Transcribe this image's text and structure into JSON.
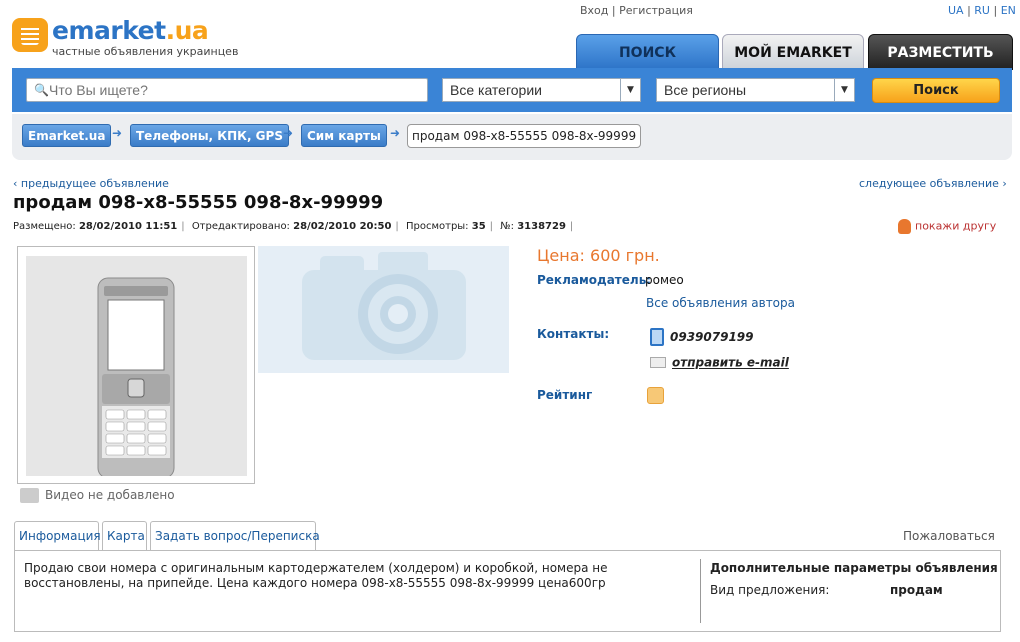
{
  "header": {
    "logo_text": "emarket",
    "logo_domain": ".ua",
    "logo_tagline": "частные объявления украинцев",
    "auth": {
      "login": "Вход",
      "register": "Регистрация"
    },
    "langs": [
      "UA",
      "RU",
      "EN"
    ],
    "tabs": {
      "search": "ПОИСК",
      "my": "МОЙ EMARKET",
      "post": "РАЗМЕСТИТЬ"
    }
  },
  "search": {
    "placeholder": "Что Вы ищете?",
    "category": "Все категории",
    "region": "Все регионы",
    "button": "Поиск"
  },
  "breadcrumb": {
    "items": [
      "Emarket.ua",
      "Телефоны, КПК, GPS",
      "Сим карты"
    ],
    "current": "продам 098-х8-55555 098-8х-99999"
  },
  "nav": {
    "prev": "‹ предыдущее объявление",
    "next": "следующее объявление ›"
  },
  "ad": {
    "title": "продам 098-х8-55555 098-8х-99999",
    "meta": {
      "posted_label": "Размещено:",
      "posted": "28/02/2010 11:51",
      "edited_label": "Отредактировано:",
      "edited": "28/02/2010 20:50",
      "views_label": "Просмотры:",
      "views": "35",
      "id_label": "№:",
      "id": "3138729"
    },
    "share": "покажи другу",
    "video": "Видео не добавлено",
    "price": "Цена: 600 грн.",
    "advertiser_label": "Рекламодатель:",
    "advertiser": "ромео",
    "author_link": "Все объявления автора",
    "contacts_label": "Контакты:",
    "phone": "0939079199",
    "email_link": "отправить e-mail",
    "rating_label": "Рейтинг"
  },
  "tabs": {
    "info": "Информация",
    "map": "Карта",
    "ask": "Задать вопрос/Переписка",
    "complain": "Пожаловаться"
  },
  "content": {
    "description": "Продаю свои номера с оригинальным картодержателем (холдером) и коробкой, номера не восстановлены, на припейде. Цена каждого номера 098-х8-55555 098-8х-99999 цена600гр",
    "extra_title": "Дополнительные параметры объявления",
    "extra_key": "Вид предложения:",
    "extra_value": "продам"
  },
  "colors": {
    "brand_blue": "#3a84d6",
    "accent_orange": "#f7a21b",
    "price": "#e8772e"
  }
}
